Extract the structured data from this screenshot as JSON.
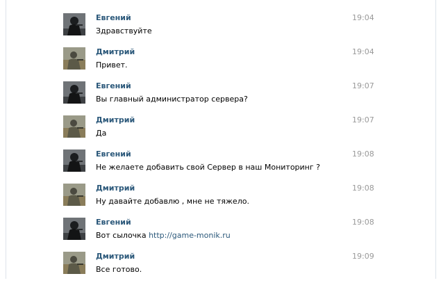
{
  "messages": [
    {
      "author": "Евгений",
      "time": "19:04",
      "text": "Здравствуйте",
      "avatar": "evgeny-avatar"
    },
    {
      "author": "Дмитрий",
      "time": "19:04",
      "text": "Привет.",
      "avatar": "dmitry-avatar"
    },
    {
      "author": "Евгений",
      "time": "19:07",
      "text": "Вы главный администратор сервера?",
      "avatar": "evgeny-avatar"
    },
    {
      "author": "Дмитрий",
      "time": "19:07",
      "text": "Да",
      "avatar": "dmitry-avatar"
    },
    {
      "author": "Евгений",
      "time": "19:08",
      "text": "Не желаете добавить свой Сервер в наш Мониторинг ?",
      "avatar": "evgeny-avatar"
    },
    {
      "author": "Дмитрий",
      "time": "19:08",
      "text": "Ну давайте добавлю , мне не тяжело.",
      "avatar": "dmitry-avatar"
    },
    {
      "author": "Евгений",
      "time": "19:08",
      "text": "Вот сылочка ",
      "link": "http://game-monik.ru",
      "avatar": "evgeny-avatar"
    },
    {
      "author": "Дмитрий",
      "time": "19:09",
      "text": "Все готово.",
      "avatar": "dmitry-avatar"
    }
  ],
  "colors": {
    "author": "#2b587a",
    "time": "#999999",
    "text": "#000000",
    "link": "#2b587a",
    "border": "#dde3ea"
  }
}
